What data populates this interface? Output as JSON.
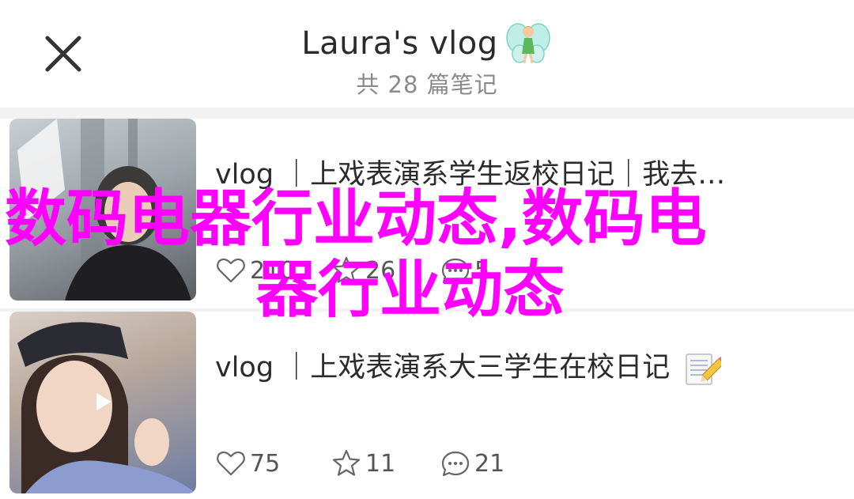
{
  "header": {
    "title": "Laura's vlog",
    "subtitle": "共 28 篇笔记"
  },
  "notes": [
    {
      "title": "vlog ｜上戏表演系学生返校日记｜我去…",
      "likes": "210",
      "favorites": "26",
      "comments": "5"
    },
    {
      "title": "vlog ｜上戏表演系大三学生在校日记",
      "likes": "75",
      "favorites": "11",
      "comments": "21"
    }
  ],
  "watermark": {
    "line1": "数码电器行业动态,数码电",
    "line2": "器行业动态"
  },
  "colors": {
    "watermark": "#ff00ff",
    "list_background": "#f2f2f2",
    "subtitle": "#8a8a8a"
  },
  "icons": [
    "close-icon",
    "fairy-emoji-icon",
    "video-play-icon",
    "heart-icon",
    "star-icon",
    "comment-icon",
    "memo-pencil-emoji-icon"
  ]
}
